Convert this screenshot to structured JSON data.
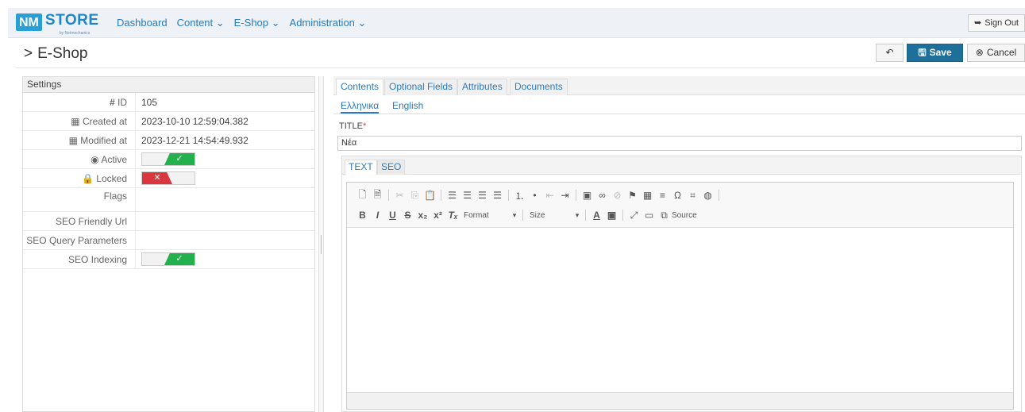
{
  "app": {
    "logo_nm": "NM",
    "logo_store": "STORE",
    "logo_by": "by Netmechanics",
    "nav": [
      "Dashboard",
      "Content ⌄",
      "E-Shop ⌄",
      "Administration ⌄"
    ],
    "sign_out": "Sign Out"
  },
  "page": {
    "title": "E-Shop",
    "save": "Save",
    "cancel": "Cancel"
  },
  "settings": {
    "header": "Settings",
    "id_label": "ID",
    "id_value": "105",
    "created_label": "Created at",
    "created_value": "2023-10-10 12:59:04.382",
    "modified_label": "Modified at",
    "modified_value": "2023-12-21 14:54:49.932",
    "active_label": "Active",
    "active_on": true,
    "locked_label": "Locked",
    "locked_on": false,
    "flags_label": "Flags",
    "seo_url_label": "SEO Friendly Url",
    "seo_query_label": "SEO Query Parameters",
    "seo_indexing_label": "SEO Indexing",
    "seo_indexing_on": true,
    "check_glyph": "✓",
    "cross_glyph": "✕"
  },
  "content": {
    "tabs": [
      "Contents",
      "Optional Fields",
      "Attributes",
      "Documents"
    ],
    "languages": [
      "Ελληνικα",
      "English"
    ],
    "title_label": "TITLE",
    "title_required": "*",
    "title_value": "Νέα",
    "editor_tabs": [
      "TEXT",
      "SEO"
    ],
    "toolbar_format": "Format",
    "toolbar_size": "Size",
    "toolbar_source": "Source"
  },
  "colors": {
    "accent": "#2a7bbf",
    "save_button": "#1e6f99",
    "toggle_on": "#22b14c",
    "toggle_off": "#d9363e"
  }
}
